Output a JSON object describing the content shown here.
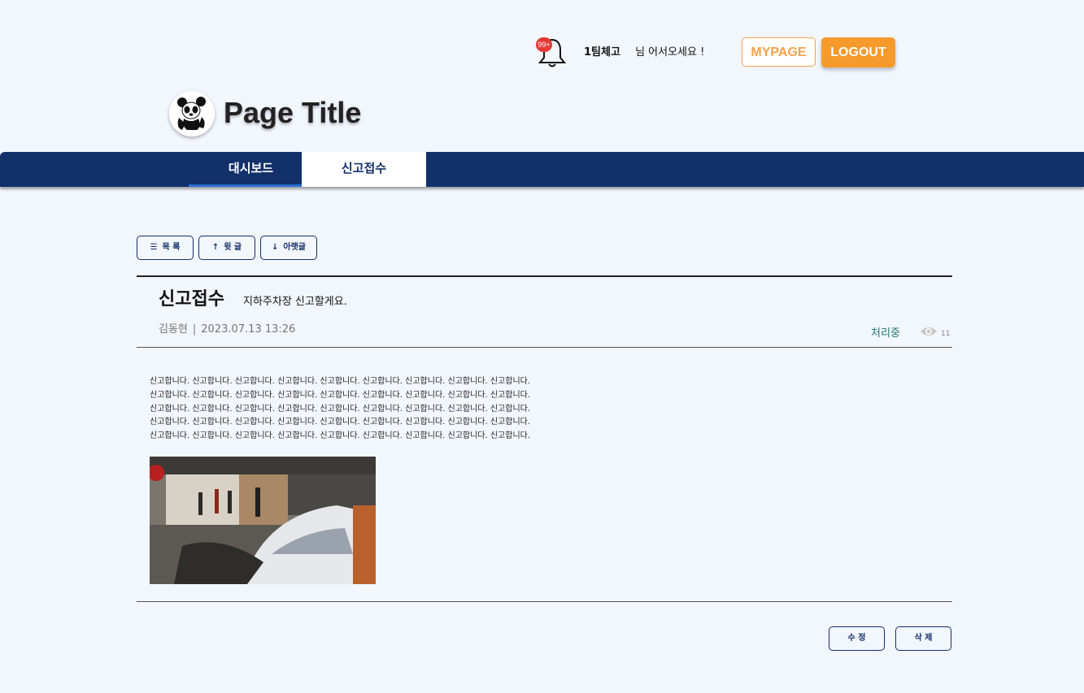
{
  "header": {
    "notification_count": "99+",
    "team": "1팀체고",
    "welcome": "님 어서오세요 !",
    "mypage_label": "MYPAGE",
    "logout_label": "LOGOUT",
    "page_title": "Page Title"
  },
  "nav": {
    "tabs": [
      {
        "label": "대시보드",
        "active": false
      },
      {
        "label": "신고접수",
        "active": true
      }
    ]
  },
  "toolbar": {
    "list_label": "목 록",
    "prev_label": "윗 글",
    "next_label": "아랫글"
  },
  "post": {
    "category": "신고접수",
    "title": "지하주차장  신고할게요.",
    "author": "김동현",
    "separator": "|",
    "datetime": "2023.07.13 13:26",
    "status": "처리중",
    "views": "11",
    "body_lines": [
      "신고합니다. 신고합니다. 신고합니다. 신고합니다. 신고합니다. 신고합니다. 신고합니다. 신고합니다. 신고합니다.",
      "신고합니다. 신고합니다. 신고합니다. 신고합니다. 신고합니다. 신고합니다. 신고합니다. 신고합니다. 신고합니다.",
      "신고합니다. 신고합니다. 신고합니다. 신고합니다. 신고합니다. 신고합니다. 신고합니다. 신고합니다. 신고합니다.",
      "신고합니다. 신고합니다. 신고합니다. 신고합니다. 신고합니다. 신고합니다. 신고합니다. 신고합니다. 신고합니다.",
      "신고합니다. 신고합니다. 신고합니다. 신고합니다. 신고합니다. 신고합니다. 신고합니다. 신고합니다. 신고합니다."
    ]
  },
  "actions": {
    "edit_label": "수 정",
    "delete_label": "삭 제"
  },
  "colors": {
    "navy": "#12306a",
    "accent_orange": "#f79a2c",
    "status_green": "#1e7a6e",
    "background": "#f2f6fd"
  }
}
